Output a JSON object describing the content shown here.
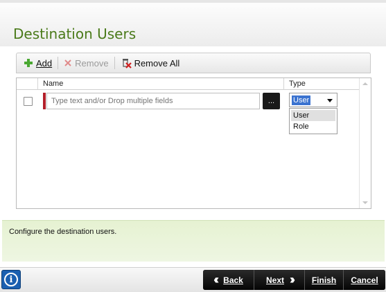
{
  "header": {
    "title": "Destination Users"
  },
  "toolbar": {
    "add_label": "Add",
    "remove_label": "Remove",
    "remove_all_label": "Remove All"
  },
  "grid": {
    "columns": [
      "Name",
      "Type"
    ],
    "rows": [
      {
        "name_placeholder": "Type text and/or Drop multiple fields",
        "browse_label": "...",
        "type_value": "User"
      }
    ],
    "type_options": [
      "User",
      "Role"
    ]
  },
  "info": {
    "text": "Configure the destination users."
  },
  "footer": {
    "back_label": "Back",
    "next_label": "Next",
    "finish_label": "Finish",
    "cancel_label": "Cancel"
  },
  "colors": {
    "title": "#4a7a1a",
    "required": "#b3202a",
    "selection": "#3b73d0",
    "info_panel": "#e6f2d2",
    "nav_button": "#111111"
  }
}
